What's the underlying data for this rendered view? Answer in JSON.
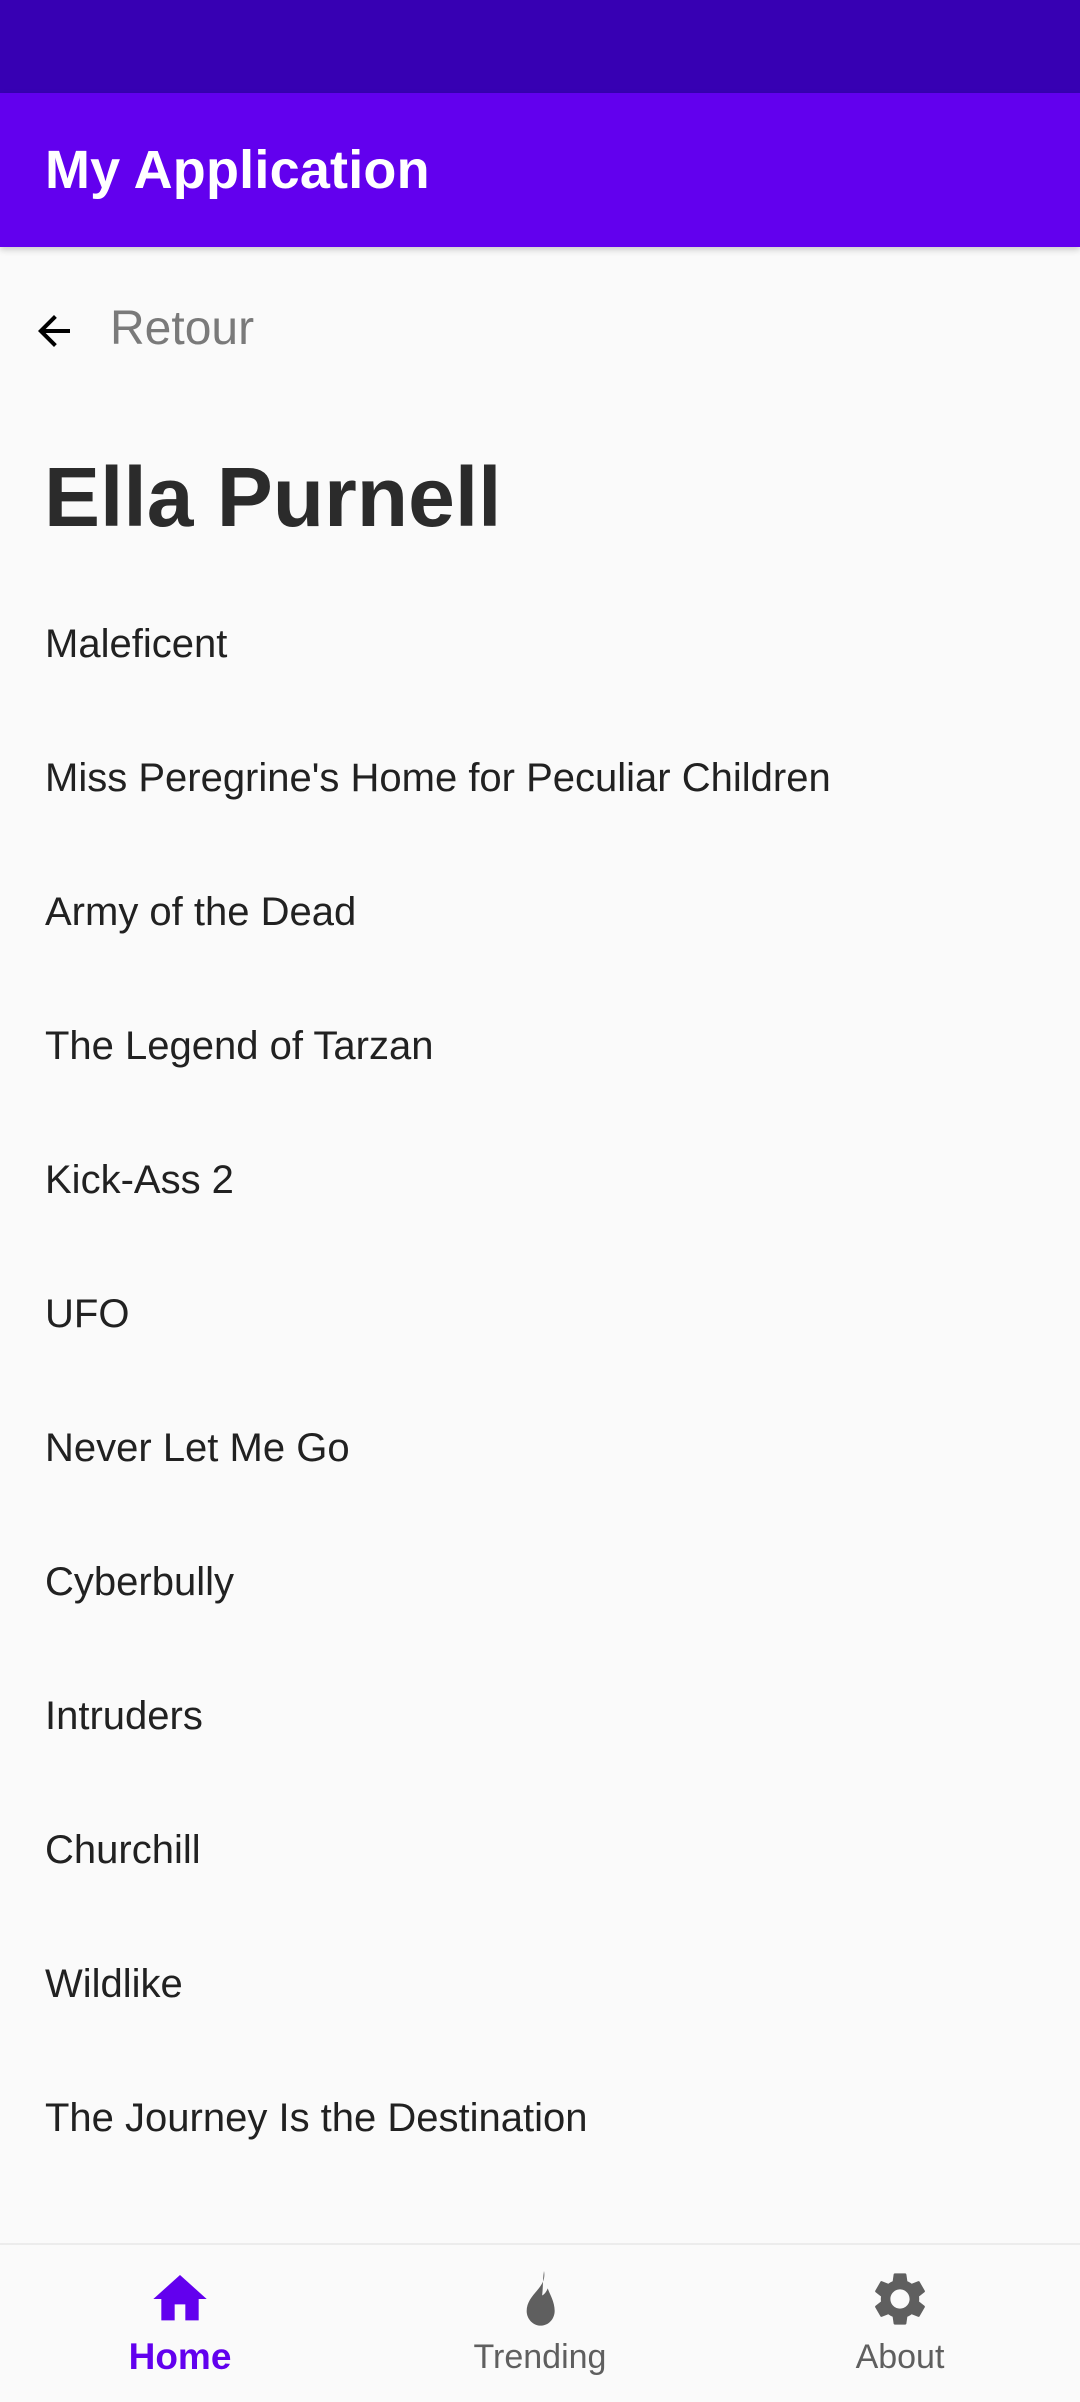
{
  "app_bar": {
    "title": "My Application"
  },
  "back": {
    "label": "Retour",
    "icon": "arrow-back-icon"
  },
  "page": {
    "title": "Ella Purnell"
  },
  "movies": [
    "Maleficent",
    "Miss Peregrine's Home for Peculiar Children",
    "Army of the Dead",
    "The Legend of Tarzan",
    "Kick-Ass 2",
    "UFO",
    "Never Let Me Go",
    "Cyberbully",
    "Intruders",
    "Churchill",
    "Wildlike",
    "The Journey Is the Destination"
  ],
  "bottom_nav": {
    "items": [
      {
        "label": "Home",
        "icon": "home-icon",
        "active": true
      },
      {
        "label": "Trending",
        "icon": "fire-icon",
        "active": false
      },
      {
        "label": "About",
        "icon": "gear-icon",
        "active": false
      }
    ]
  },
  "colors": {
    "status_bar": "#3700b3",
    "primary": "#6200ee",
    "background": "#fafafa",
    "inactive_icon": "#5f5f5f"
  }
}
